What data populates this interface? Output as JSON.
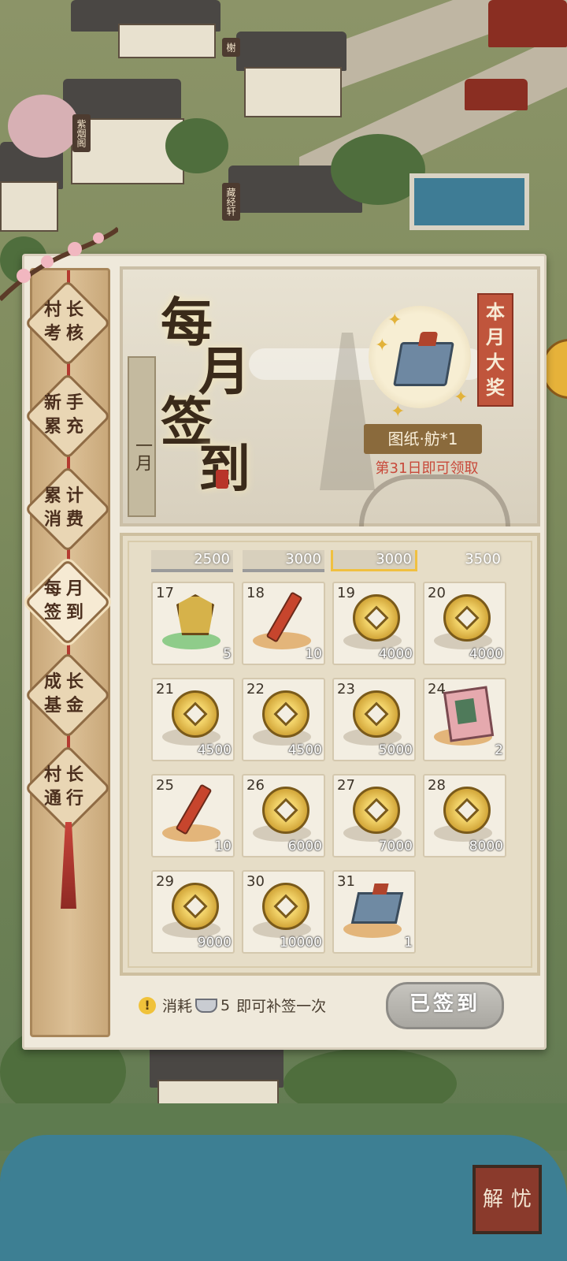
{
  "background": {
    "building_signs": [
      "紫烟阁",
      "藏经轩",
      "榭"
    ],
    "corner_button": {
      "label_1": "解",
      "label_2": "忧"
    }
  },
  "sidenav": {
    "items": [
      {
        "line1": "村长",
        "line2": "考核",
        "active": false
      },
      {
        "line1": "新手",
        "line2": "累充",
        "active": false
      },
      {
        "line1": "累计",
        "line2": "消费",
        "active": false
      },
      {
        "line1": "每月",
        "line2": "签到",
        "active": true
      },
      {
        "line1": "成长",
        "line2": "基金",
        "active": false
      },
      {
        "line1": "村长",
        "line2": "通行",
        "active": false
      }
    ]
  },
  "banner": {
    "title_chars": [
      "每",
      "月",
      "签",
      "到"
    ],
    "month": "一月",
    "grand_prize_label": [
      "本",
      "月",
      "大",
      "奖"
    ],
    "prize_name": "图纸·舫*1",
    "prize_hint": "第31日即可领取"
  },
  "grid": {
    "partial_amounts": [
      "2500",
      "3000",
      "3000",
      "3500"
    ],
    "days": [
      {
        "day": "17",
        "item": "amulet",
        "amount": "5"
      },
      {
        "day": "18",
        "item": "firecracker",
        "amount": "10"
      },
      {
        "day": "19",
        "item": "coin",
        "amount": "4000"
      },
      {
        "day": "20",
        "item": "coin",
        "amount": "4000"
      },
      {
        "day": "21",
        "item": "coin",
        "amount": "4500"
      },
      {
        "day": "22",
        "item": "coin",
        "amount": "4500"
      },
      {
        "day": "23",
        "item": "coin",
        "amount": "5000"
      },
      {
        "day": "24",
        "item": "card",
        "amount": "2"
      },
      {
        "day": "25",
        "item": "firecracker",
        "amount": "10"
      },
      {
        "day": "26",
        "item": "coin",
        "amount": "6000"
      },
      {
        "day": "27",
        "item": "coin",
        "amount": "7000"
      },
      {
        "day": "28",
        "item": "coin",
        "amount": "8000"
      },
      {
        "day": "29",
        "item": "coin",
        "amount": "9000"
      },
      {
        "day": "30",
        "item": "coin",
        "amount": "10000"
      },
      {
        "day": "31",
        "item": "blueprint",
        "amount": "1"
      }
    ]
  },
  "footer": {
    "note_prefix": "消耗",
    "note_count": "5",
    "note_suffix": "即可补签一次",
    "signed_button": "已签到"
  }
}
